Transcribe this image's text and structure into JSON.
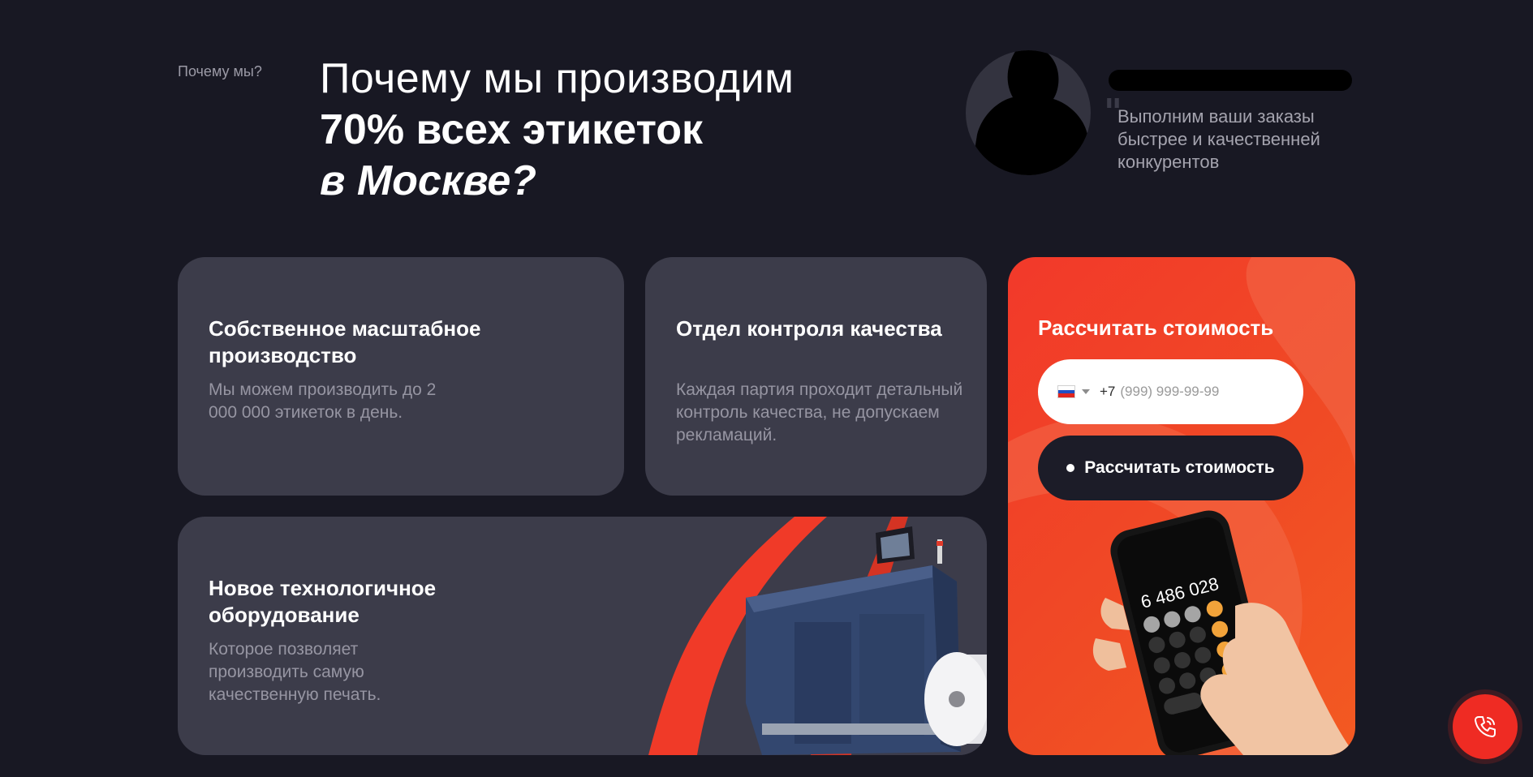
{
  "header": {
    "eyebrow": "Почему мы?",
    "headline_line1": "Почему мы производим",
    "headline_line2": "70% всех этикеток",
    "headline_line3": "в Москве?"
  },
  "manager": {
    "quote": "Выполним ваши заказы быстрее и качественней конкурентов"
  },
  "features": [
    {
      "title": "Собственное масштабное производство",
      "text": "Мы можем производить до 2 000 000 этикеток в день."
    },
    {
      "title": "Отдел контроля качества",
      "text": "Каждая партия проходит детальный контроль качества, не допускаем рекламаций."
    },
    {
      "title": "Новое технологичное оборудование",
      "text": "Которое позволяет производить самую качественную печать."
    }
  ],
  "calculator": {
    "title": "Рассчитать стоимость",
    "phone_code": "+7",
    "phone_placeholder": "(999) 999-99-99",
    "button_label": "Рассчитать стоимость",
    "phone_screen_value": "6 486 028"
  },
  "colors": {
    "background": "#181823",
    "card": "#3c3c4a",
    "accent": "#f03a28"
  },
  "icons": {
    "call": "phone-call-icon",
    "flag": "russia-flag-icon"
  }
}
